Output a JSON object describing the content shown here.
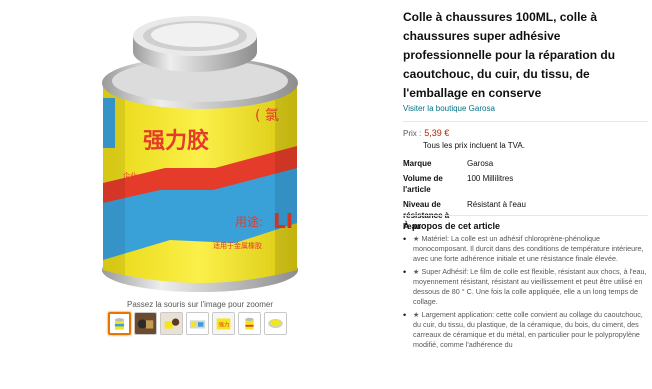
{
  "product": {
    "title": "Colle à chaussures 100ML, colle à chaussures super adhésive professionnelle pour la réparation du caoutchouc, du cuir, du tissu, de l'emballage en conserve",
    "store_link": "Visiter la boutique Garosa",
    "price_label": "Prix :",
    "price": "5,39 €",
    "tax_note": "Tous les prix incluent la TVA."
  },
  "image": {
    "hover_hint": "Passez la souris sur l'image pour zoomer",
    "can_text": "强力胶",
    "thumbnails": [
      "thumb-1",
      "thumb-2",
      "thumb-3",
      "thumb-4",
      "thumb-5",
      "thumb-6",
      "thumb-7"
    ]
  },
  "specs": [
    {
      "key": "Marque",
      "value": "Garosa"
    },
    {
      "key": "Volume de l'article",
      "value": "100 Millilitres"
    },
    {
      "key": "Niveau de résistance à l'eau",
      "value": "Résistant à l'eau"
    }
  ],
  "about": {
    "title": "À propos de cet article",
    "bullets": [
      "★ Matériel: La colle est un adhésif chloroprène-phénolique monocomposant. Il durcit dans des conditions de température intérieure, avec une forte adhérence initiale et une résistance finale élevée.",
      "★ Super Adhésif: Le film de colle est flexible, résistant aux chocs, à l'eau, moyennement résistant, résistant au vieillissement et peut être utilisé en dessous de 80 ° C. Une fois la colle appliquée, elle a un long temps de collage.",
      "★ Largement application: cette colle convient au collage du caoutchouc, du cuir, du tissu, du plastique, de la céramique, du bois, du ciment, des carreaux de céramique et du métal, en particulier pour le polypropylène modifié, comme l'adhérence du"
    ]
  },
  "colors": {
    "price": "#b12704",
    "link": "#007185",
    "can_yellow": "#f2e61c",
    "can_red": "#e53b2a",
    "can_blue": "#3aa0d8"
  }
}
